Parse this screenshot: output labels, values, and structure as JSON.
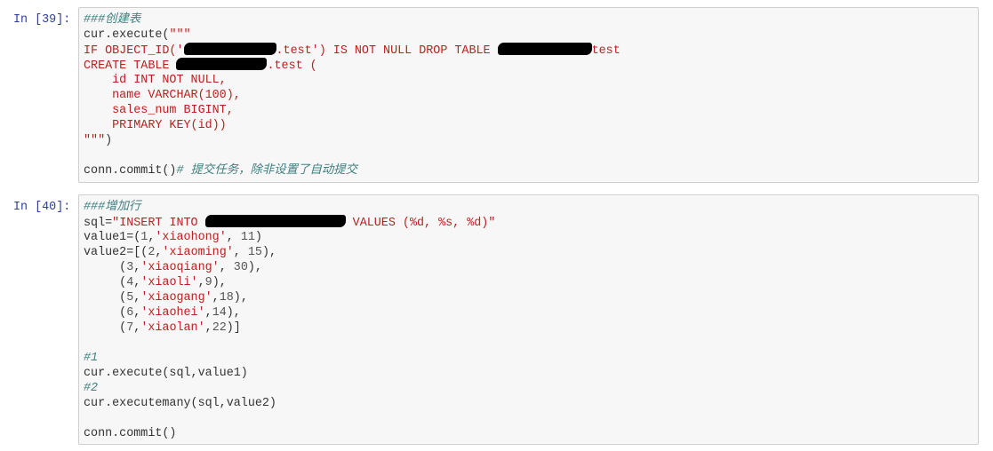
{
  "cells": [
    {
      "prompt": "In [39]:",
      "lines": [
        [
          {
            "c": "com",
            "t": "###创建表"
          }
        ],
        [
          {
            "c": "",
            "t": "cur.execute("
          },
          {
            "c": "str",
            "t": "\"\"\""
          }
        ],
        [
          {
            "c": "str",
            "t": "IF OBJECT_ID('"
          },
          {
            "c": "red",
            "t": ""
          },
          {
            "c": "str",
            "t": ".test') IS NOT NULL DROP TABLE "
          },
          {
            "c": "red",
            "t": ""
          },
          {
            "c": "str",
            "t": "test"
          }
        ],
        [
          {
            "c": "str",
            "t": "CREATE TABLE "
          },
          {
            "c": "red",
            "t": ""
          },
          {
            "c": "str",
            "t": ".test ("
          }
        ],
        [
          {
            "c": "str",
            "t": "    id INT NOT NULL,"
          }
        ],
        [
          {
            "c": "str",
            "t": "    name VARCHAR(100),"
          }
        ],
        [
          {
            "c": "str",
            "t": "    sales_num BIGINT,"
          }
        ],
        [
          {
            "c": "str",
            "t": "    PRIMARY KEY(id))"
          }
        ],
        [
          {
            "c": "str",
            "t": "\"\"\""
          },
          {
            "c": "",
            "t": ")"
          }
        ],
        [
          {
            "c": "",
            "t": ""
          }
        ],
        [
          {
            "c": "",
            "t": "conn.commit()"
          },
          {
            "c": "com",
            "t": "# 提交任务，除非设置了自动提交"
          }
        ]
      ]
    },
    {
      "prompt": "In [40]:",
      "lines": [
        [
          {
            "c": "com",
            "t": "###增加行"
          }
        ],
        [
          {
            "c": "",
            "t": "sql="
          },
          {
            "c": "str",
            "t": "\"INSERT INTO "
          },
          {
            "c": "red",
            "t": ""
          },
          {
            "c": "str",
            "t": " VALUES (%d, %s, %d)\""
          }
        ],
        [
          {
            "c": "",
            "t": "value1=("
          },
          {
            "c": "num",
            "t": "1"
          },
          {
            "c": "",
            "t": ","
          },
          {
            "c": "str",
            "t": "'xiaohong'"
          },
          {
            "c": "",
            "t": ", "
          },
          {
            "c": "num",
            "t": "11"
          },
          {
            "c": "",
            "t": ")"
          }
        ],
        [
          {
            "c": "",
            "t": "value2=[("
          },
          {
            "c": "num",
            "t": "2"
          },
          {
            "c": "",
            "t": ","
          },
          {
            "c": "str",
            "t": "'xiaoming'"
          },
          {
            "c": "",
            "t": ", "
          },
          {
            "c": "num",
            "t": "15"
          },
          {
            "c": "",
            "t": "),"
          }
        ],
        [
          {
            "c": "",
            "t": "     ("
          },
          {
            "c": "num",
            "t": "3"
          },
          {
            "c": "",
            "t": ","
          },
          {
            "c": "str",
            "t": "'xiaoqiang'"
          },
          {
            "c": "",
            "t": ", "
          },
          {
            "c": "num",
            "t": "30"
          },
          {
            "c": "",
            "t": "),"
          }
        ],
        [
          {
            "c": "",
            "t": "     ("
          },
          {
            "c": "num",
            "t": "4"
          },
          {
            "c": "",
            "t": ","
          },
          {
            "c": "str",
            "t": "'xiaoli'"
          },
          {
            "c": "",
            "t": ","
          },
          {
            "c": "num",
            "t": "9"
          },
          {
            "c": "",
            "t": "),"
          }
        ],
        [
          {
            "c": "",
            "t": "     ("
          },
          {
            "c": "num",
            "t": "5"
          },
          {
            "c": "",
            "t": ","
          },
          {
            "c": "str",
            "t": "'xiaogang'"
          },
          {
            "c": "",
            "t": ","
          },
          {
            "c": "num",
            "t": "18"
          },
          {
            "c": "",
            "t": "),"
          }
        ],
        [
          {
            "c": "",
            "t": "     ("
          },
          {
            "c": "num",
            "t": "6"
          },
          {
            "c": "",
            "t": ","
          },
          {
            "c": "str",
            "t": "'xiaohei'"
          },
          {
            "c": "",
            "t": ","
          },
          {
            "c": "num",
            "t": "14"
          },
          {
            "c": "",
            "t": "),"
          }
        ],
        [
          {
            "c": "",
            "t": "     ("
          },
          {
            "c": "num",
            "t": "7"
          },
          {
            "c": "",
            "t": ","
          },
          {
            "c": "str",
            "t": "'xiaolan'"
          },
          {
            "c": "",
            "t": ","
          },
          {
            "c": "num",
            "t": "22"
          },
          {
            "c": "",
            "t": ")]"
          }
        ],
        [
          {
            "c": "",
            "t": ""
          }
        ],
        [
          {
            "c": "com",
            "t": "#1"
          }
        ],
        [
          {
            "c": "",
            "t": "cur.execute(sql,value1)"
          }
        ],
        [
          {
            "c": "com",
            "t": "#2"
          }
        ],
        [
          {
            "c": "",
            "t": "cur.executemany(sql,value2)"
          }
        ],
        [
          {
            "c": "",
            "t": ""
          }
        ],
        [
          {
            "c": "",
            "t": "conn.commit()"
          }
        ]
      ]
    }
  ],
  "colors": {
    "prompt": "#303F9F",
    "string": "#BA2121",
    "comment": "#408080",
    "cell_bg": "#f7f7f7",
    "cell_border": "#cfcfcf"
  }
}
